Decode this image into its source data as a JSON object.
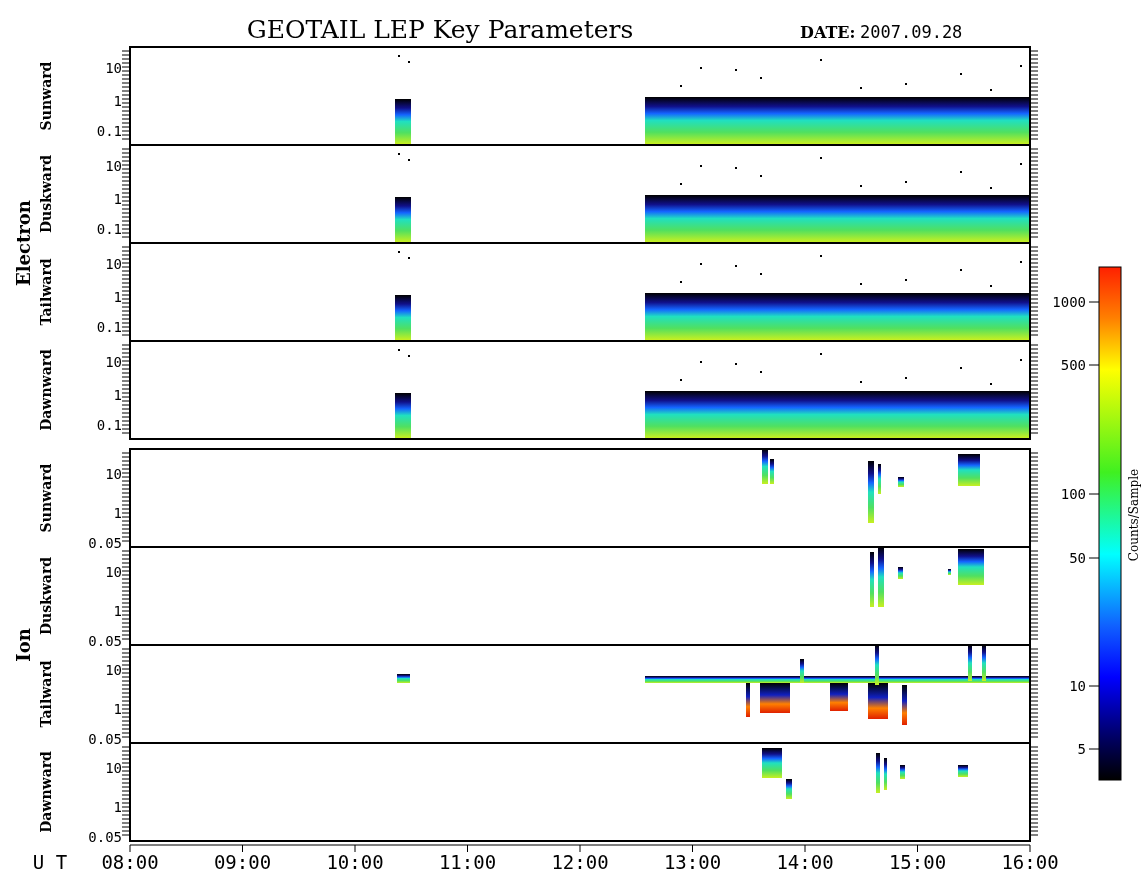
{
  "title": "GEOTAIL LEP Key Parameters",
  "date": {
    "label": "DATE:",
    "value": "2007.09.28"
  },
  "groups": [
    {
      "name": "Electron",
      "panels": [
        {
          "label": "Sunward",
          "yticks": [
            "10",
            "1",
            "0.1"
          ]
        },
        {
          "label": "Duskward",
          "yticks": [
            "10",
            "1",
            "0.1"
          ]
        },
        {
          "label": "Tailward",
          "yticks": [
            "10",
            "1",
            "0.1"
          ]
        },
        {
          "label": "Dawnward",
          "yticks": [
            "10",
            "1",
            "0.1"
          ]
        }
      ]
    },
    {
      "name": "Ion",
      "panels": [
        {
          "label": "Sunward",
          "yticks": [
            "10",
            "1",
            "0.05"
          ]
        },
        {
          "label": "Duskward",
          "yticks": [
            "10",
            "1",
            "0.05"
          ]
        },
        {
          "label": "Tailward",
          "yticks": [
            "10",
            "1",
            "0.05"
          ]
        },
        {
          "label": "Dawnward",
          "yticks": [
            "10",
            "1",
            "0.05"
          ]
        }
      ]
    }
  ],
  "x_axis": {
    "label": "U T",
    "ticks": [
      "08:00",
      "09:00",
      "10:00",
      "11:00",
      "12:00",
      "13:00",
      "14:00",
      "15:00",
      "16:00"
    ]
  },
  "colorbar": {
    "label": "Counts/Sample",
    "ticks": [
      "1000",
      "500",
      "100",
      "50",
      "10",
      "5"
    ]
  }
}
